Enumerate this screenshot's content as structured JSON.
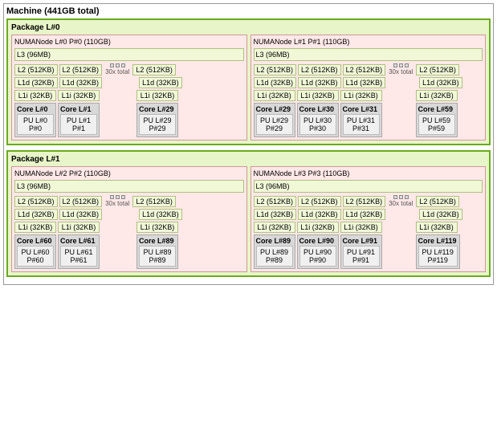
{
  "machine": {
    "label": "Machine (441GB total)",
    "packages": [
      {
        "label": "Package L#0",
        "numas": [
          {
            "label": "NUMANode L#0 P#0 (110GB)",
            "l3": "L3 (96MB)",
            "l2_cells": [
              "L2 (512KB)",
              "L2 (512KB)"
            ],
            "dots": "30x total",
            "l2_right": "L2 (512KB)",
            "l1d_cells": [
              "L1d (32KB)",
              "L1d (32KB)"
            ],
            "l1d_right": "L1d (32KB)",
            "l1i_cells": [
              "L1i (32KB)",
              "L1i (32KB)"
            ],
            "l1i_right": "L1i (32KB)",
            "cores": [
              {
                "label": "Core L#0",
                "pu": "PU L#0\nP#0"
              },
              {
                "label": "Core L#1",
                "pu": "PU L#1\nP#1"
              }
            ],
            "core_right": {
              "label": "Core L#29",
              "pu": "PU L#29\nP#29"
            }
          },
          {
            "label": "NUMANode L#1 P#1 (110GB)",
            "l3": "L3 (96MB)",
            "l2_cells": [
              "L2 (512KB)",
              "L2 (512KB)",
              "L2 (512KB)"
            ],
            "dots": "30x total",
            "l2_right": "L2 (512KB)",
            "l1d_cells": [
              "L1d (32KB)",
              "L1d (32KB)",
              "L1d (32KB)"
            ],
            "l1d_right": "L1d (32KB)",
            "l1i_cells": [
              "L1i (32KB)",
              "L1i (32KB)",
              "L1i (32KB)"
            ],
            "l1i_right": "L1i (32KB)",
            "cores": [
              {
                "label": "Core L#29",
                "pu": "PU L#29\nP#29"
              },
              {
                "label": "Core L#30",
                "pu": "PU L#30\nP#30"
              },
              {
                "label": "Core L#31",
                "pu": "PU L#31\nP#31"
              }
            ],
            "core_right": {
              "label": "Core L#59",
              "pu": "PU L#59\nP#59"
            }
          }
        ]
      },
      {
        "label": "Package L#1",
        "numas": [
          {
            "label": "NUMANode L#2 P#2 (110GB)",
            "l3": "L3 (96MB)",
            "l2_cells": [
              "L2 (512KB)",
              "L2 (512KB)"
            ],
            "dots": "30x total",
            "l2_right": "L2 (512KB)",
            "l1d_cells": [
              "L1d (32KB)",
              "L1d (32KB)"
            ],
            "l1d_right": "L1d (32KB)",
            "l1i_cells": [
              "L1i (32KB)",
              "L1i (32KB)"
            ],
            "l1i_right": "L1i (32KB)",
            "cores": [
              {
                "label": "Core L#60",
                "pu": "PU L#60\nP#60"
              },
              {
                "label": "Core L#61",
                "pu": "PU L#61\nP#61"
              }
            ],
            "core_right": {
              "label": "Core L#89",
              "pu": "PU L#89\nP#89"
            }
          },
          {
            "label": "NUMANode L#3 P#3 (110GB)",
            "l3": "L3 (96MB)",
            "l2_cells": [
              "L2 (512KB)",
              "L2 (512KB)",
              "L2 (512KB)"
            ],
            "dots": "30x total",
            "l2_right": "L2 (512KB)",
            "l1d_cells": [
              "L1d (32KB)",
              "L1d (32KB)",
              "L1d (32KB)"
            ],
            "l1d_right": "L1d (32KB)",
            "l1i_cells": [
              "L1i (32KB)",
              "L1i (32KB)",
              "L1i (32KB)"
            ],
            "l1i_right": "L1i (32KB)",
            "cores": [
              {
                "label": "Core L#89",
                "pu": "PU L#89\nP#89"
              },
              {
                "label": "Core L#90",
                "pu": "PU L#90\nP#90"
              },
              {
                "label": "Core L#91",
                "pu": "PU L#91\nP#91"
              }
            ],
            "core_right": {
              "label": "Core L#119",
              "pu": "PU L#119\nP#119"
            }
          }
        ]
      }
    ]
  }
}
